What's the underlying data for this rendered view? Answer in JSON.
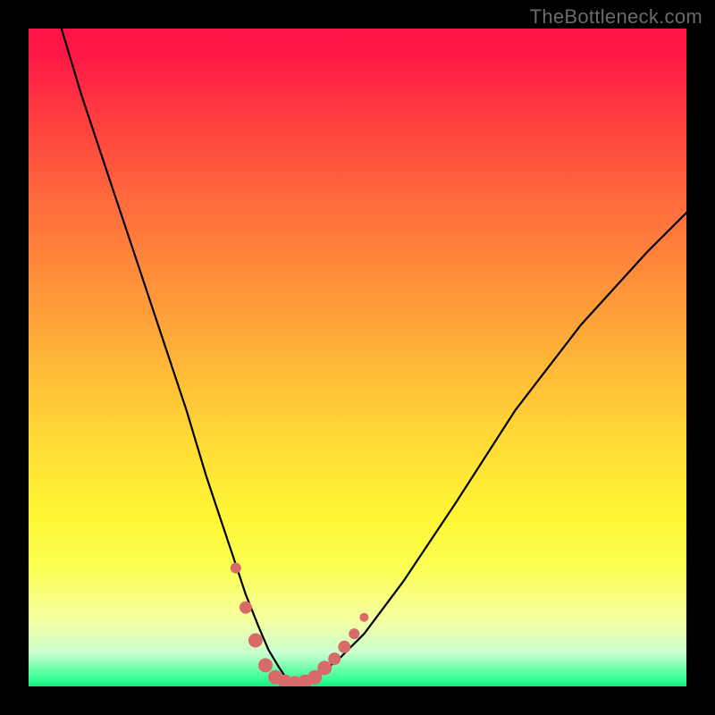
{
  "watermark": "TheBottleneck.com",
  "colors": {
    "curve": "#000000",
    "markers": "#d86a6a",
    "frame": "#000000"
  },
  "chart_data": {
    "type": "line",
    "title": "",
    "xlabel": "",
    "ylabel": "",
    "xlim": [
      0,
      100
    ],
    "ylim": [
      0,
      100
    ],
    "grid": false,
    "legend": false,
    "series": [
      {
        "name": "bottleneck-curve",
        "x": [
          5,
          8,
          12,
          16,
          20,
          24,
          27,
          29,
          31,
          33,
          35,
          36.5,
          38,
          39,
          40,
          41,
          42,
          44,
          47,
          51,
          57,
          65,
          74,
          84,
          94,
          100
        ],
        "y": [
          100,
          90,
          78,
          66,
          54,
          42,
          32,
          26,
          20,
          14,
          9,
          5.5,
          3,
          1.5,
          0.8,
          0.5,
          0.8,
          1.8,
          4,
          8,
          16,
          28,
          42,
          55,
          66,
          72
        ]
      }
    ],
    "markers": [
      {
        "x": 31.5,
        "y": 18,
        "r": 6
      },
      {
        "x": 33.0,
        "y": 12,
        "r": 7
      },
      {
        "x": 34.5,
        "y": 7,
        "r": 8
      },
      {
        "x": 36.0,
        "y": 3.2,
        "r": 8
      },
      {
        "x": 37.5,
        "y": 1.4,
        "r": 8
      },
      {
        "x": 39.0,
        "y": 0.7,
        "r": 8
      },
      {
        "x": 40.5,
        "y": 0.5,
        "r": 8
      },
      {
        "x": 42.0,
        "y": 0.7,
        "r": 8
      },
      {
        "x": 43.5,
        "y": 1.4,
        "r": 8
      },
      {
        "x": 45.0,
        "y": 2.8,
        "r": 8
      },
      {
        "x": 46.5,
        "y": 4.2,
        "r": 7
      },
      {
        "x": 48.0,
        "y": 6.0,
        "r": 7
      },
      {
        "x": 49.5,
        "y": 8.0,
        "r": 6
      },
      {
        "x": 51.0,
        "y": 10.5,
        "r": 5
      }
    ]
  }
}
